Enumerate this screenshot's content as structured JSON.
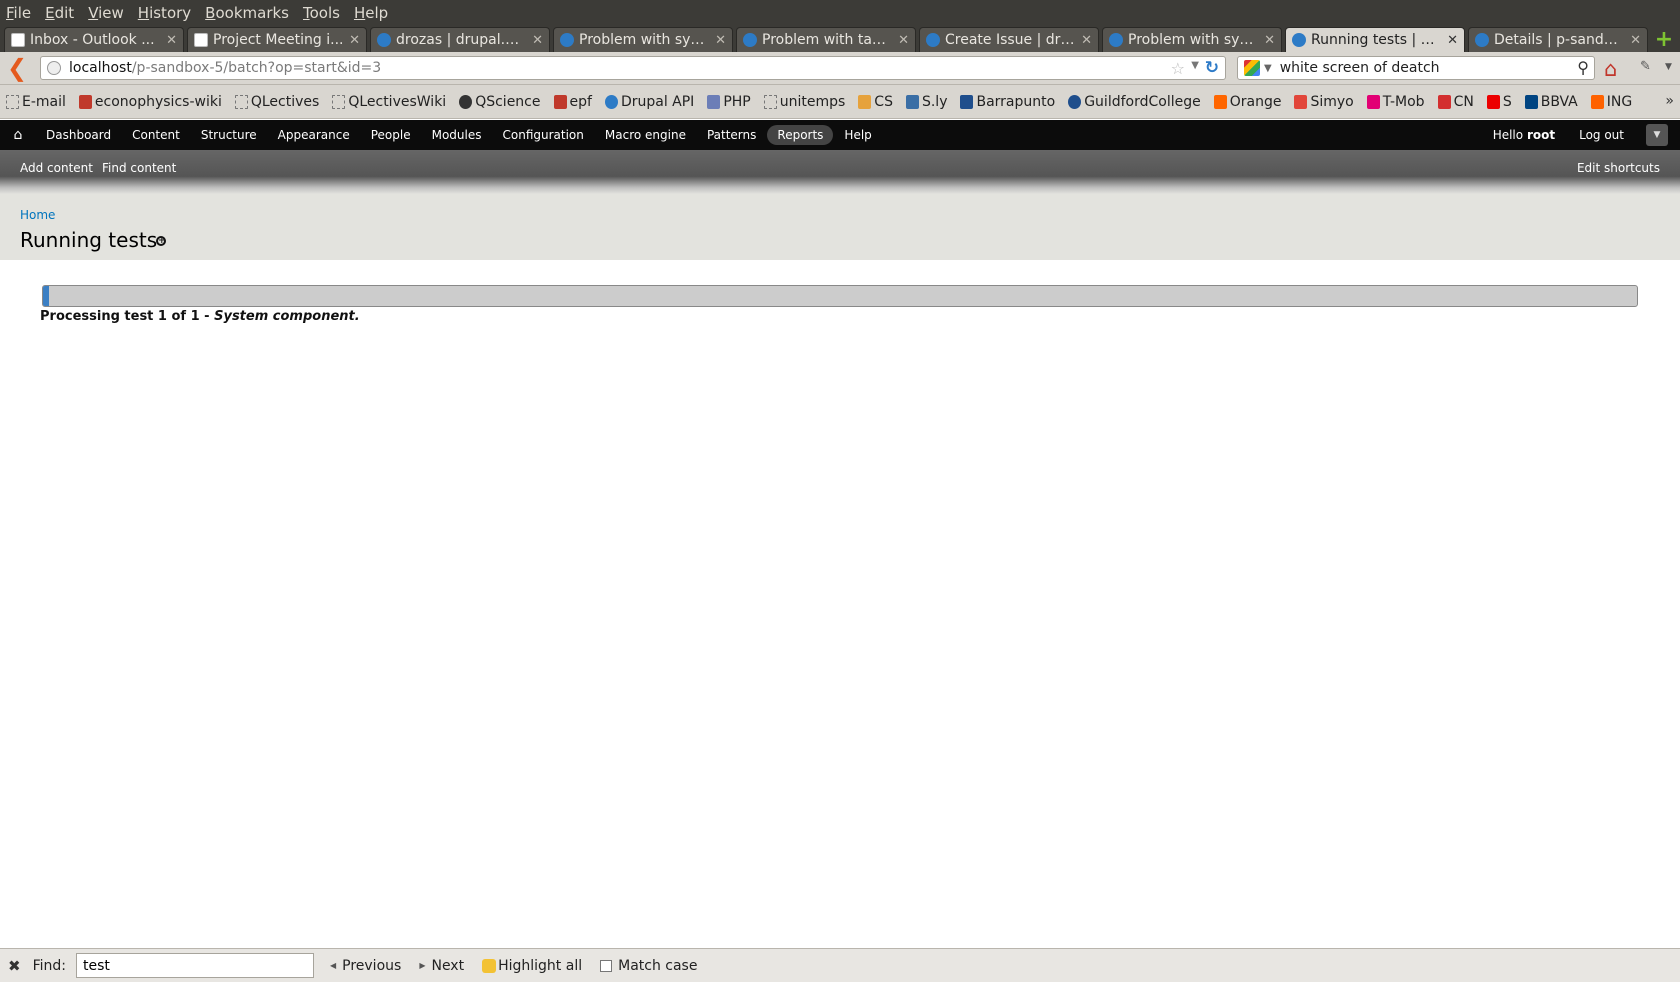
{
  "menubar": {
    "items": [
      {
        "first": "F",
        "rest": "ile"
      },
      {
        "first": "E",
        "rest": "dit"
      },
      {
        "first": "V",
        "rest": "iew"
      },
      {
        "first": "H",
        "rest": "istory"
      },
      {
        "first": "B",
        "rest": "ookmarks"
      },
      {
        "first": "T",
        "rest": "ools"
      },
      {
        "first": "H",
        "rest": "elp"
      }
    ]
  },
  "tabs": [
    {
      "title": "Inbox - Outlook ...",
      "icon": "page-icon"
    },
    {
      "title": "Project Meeting i...",
      "icon": "page-icon"
    },
    {
      "title": "drozas | drupal.org",
      "icon": "drupal-icon"
    },
    {
      "title": "Problem with sys...",
      "icon": "drupal-icon"
    },
    {
      "title": "Problem with tax...",
      "icon": "drupal-icon"
    },
    {
      "title": "Create Issue | dru...",
      "icon": "drupal-icon"
    },
    {
      "title": "Problem with sys...",
      "icon": "drupal-icon"
    },
    {
      "title": "Running tests | p-...",
      "icon": "drupal-icon",
      "active": true
    },
    {
      "title": "Details | p-sandb...",
      "icon": "drupal-icon"
    }
  ],
  "tab_close_glyph": "✕",
  "new_tab_glyph": "+",
  "url": {
    "host": "localhost",
    "path": "/p-sandbox-5/batch?op=start&id=3"
  },
  "search": {
    "value": "white screen of deatch"
  },
  "bookmarks": [
    {
      "label": "E-mail",
      "icon": "page-icon",
      "color": ""
    },
    {
      "label": "econophysics-wiki",
      "icon": "ep-icon",
      "color": "#c0392b"
    },
    {
      "label": "QLectives",
      "icon": "page-icon",
      "color": ""
    },
    {
      "label": "QLectivesWiki",
      "icon": "page-icon",
      "color": ""
    },
    {
      "label": "QScience",
      "icon": "github-icon",
      "color": "#333333"
    },
    {
      "label": "epf",
      "icon": "ep-icon",
      "color": "#c0392b"
    },
    {
      "label": "Drupal API",
      "icon": "drupal-icon",
      "color": "#2d7bc6"
    },
    {
      "label": "PHP",
      "icon": "php-icon",
      "color": "#6c7eb7"
    },
    {
      "label": "unitemps",
      "icon": "page-icon",
      "color": ""
    },
    {
      "label": "CS",
      "icon": "cs-icon",
      "color": "#e6a23c"
    },
    {
      "label": "S.ly",
      "icon": "sly-icon",
      "color": "#3a6ea5"
    },
    {
      "label": "Barrapunto",
      "icon": "barrapunto-icon",
      "color": "#1f4e8c"
    },
    {
      "label": "GuildfordCollege",
      "icon": "globe-icon",
      "color": "#1f4e8c"
    },
    {
      "label": "Orange",
      "icon": "orange-icon",
      "color": "#ff6600"
    },
    {
      "label": "Simyo",
      "icon": "simyo-icon",
      "color": "#e2463a"
    },
    {
      "label": "T-Mob",
      "icon": "tmobile-icon",
      "color": "#e20074"
    },
    {
      "label": "CN",
      "icon": "cn-icon",
      "color": "#d32f2f"
    },
    {
      "label": "S",
      "icon": "santander-icon",
      "color": "#ec0000"
    },
    {
      "label": "BBVA",
      "icon": "bbva-icon",
      "color": "#004481"
    },
    {
      "label": "ING",
      "icon": "ing-icon",
      "color": "#ff6200"
    }
  ],
  "toolbar": {
    "items": [
      {
        "label": "Dashboard"
      },
      {
        "label": "Content"
      },
      {
        "label": "Structure"
      },
      {
        "label": "Appearance"
      },
      {
        "label": "People"
      },
      {
        "label": "Modules"
      },
      {
        "label": "Configuration"
      },
      {
        "label": "Macro engine"
      },
      {
        "label": "Patterns"
      },
      {
        "label": "Reports",
        "active": true
      },
      {
        "label": "Help"
      }
    ],
    "hello": "Hello",
    "user": "root",
    "logout": "Log out"
  },
  "shortcuts": {
    "items": [
      "Add content",
      "Find content"
    ],
    "edit": "Edit shortcuts"
  },
  "page": {
    "breadcrumb": "Home",
    "title": "Running tests"
  },
  "progress": {
    "percent": 0.4,
    "message_prefix": "Processing test 1 of 1 - ",
    "message_emph": "System component."
  },
  "findbar": {
    "label": "Find:",
    "value": "test",
    "previous": "Previous",
    "next": "Next",
    "highlight_all": "Highlight all",
    "match_case": "Match case"
  },
  "colors": {
    "accent_link": "#0074bd",
    "toolbar_bg": "#0c0c0c",
    "progress_fill": "#3b7fc4"
  }
}
